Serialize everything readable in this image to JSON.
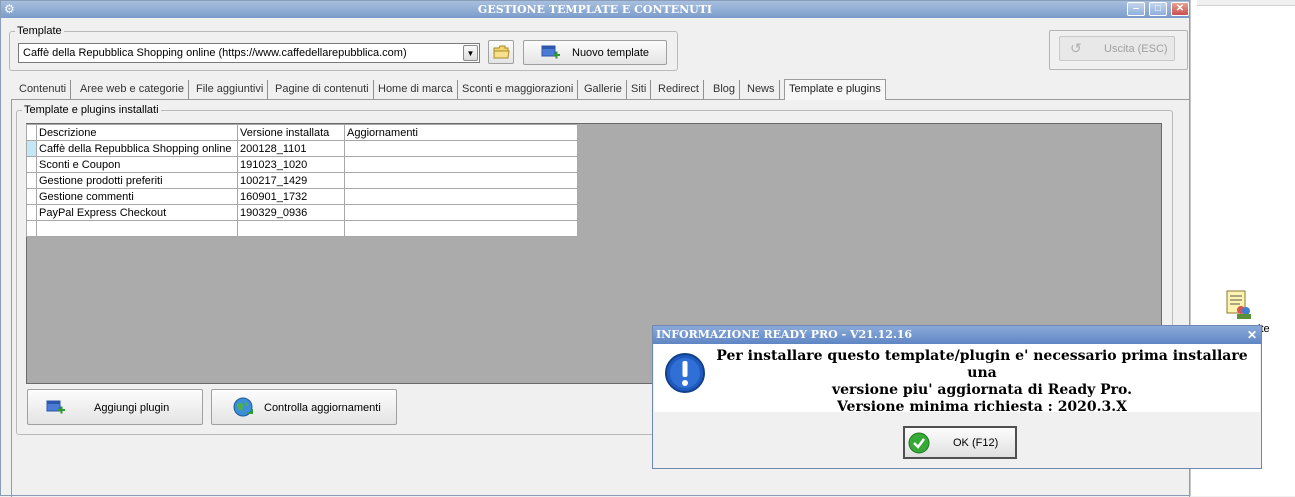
{
  "window": {
    "title": "GESTIONE TEMPLATE E CONTENUTI",
    "min_label": "‒",
    "max_label": "□",
    "close_label": "✕"
  },
  "template_group": {
    "legend": "Template",
    "selected": "Caffè della Repubblica Shopping online (https://www.caffedellarepubblica.com)",
    "new_label": "Nuovo template"
  },
  "exit_label": "Uscita (ESC)",
  "tabs": [
    {
      "label": "Contenuti",
      "active": false
    },
    {
      "label": "Aree web e categorie",
      "active": false
    },
    {
      "label": "File aggiuntivi",
      "active": false
    },
    {
      "label": "Pagine di contenuti",
      "active": false
    },
    {
      "label": "Home di marca",
      "active": false
    },
    {
      "label": "Sconti e maggiorazioni",
      "active": false
    },
    {
      "label": "Gallerie",
      "active": false
    },
    {
      "label": "Siti",
      "active": false
    },
    {
      "label": "Redirect",
      "active": false
    },
    {
      "label": "Blog",
      "active": false
    },
    {
      "label": "News",
      "active": false
    },
    {
      "label": "Template e plugins",
      "active": true
    }
  ],
  "plugins_group": {
    "legend": "Template e plugins installati",
    "columns": [
      "Descrizione",
      "Versione installata",
      "Aggiornamenti"
    ],
    "rows": [
      [
        "Caffè della Repubblica Shopping online",
        "200128_1101",
        ""
      ],
      [
        "Sconti e Coupon",
        "191023_1020",
        ""
      ],
      [
        "Gestione prodotti preferiti",
        "100217_1429",
        ""
      ],
      [
        "Gestione commenti",
        "160901_1732",
        ""
      ],
      [
        "PayPal Express Checkout",
        "190329_0936",
        ""
      ],
      [
        "",
        "",
        ""
      ]
    ],
    "add_label": "Aggiungi plugin",
    "check_label": "Controlla aggiornamenti"
  },
  "side_panel": {
    "label": "ite"
  },
  "dialog": {
    "title": "INFORMAZIONE READY PRO - V21.12.16",
    "close_label": "✕",
    "message_lines": [
      "Per installare questo template/plugin e' necessario prima installare una",
      "versione piu' aggiornata di Ready Pro.",
      "Versione minima richiesta : 2020.3.X"
    ],
    "ok_label": "OK (F12)"
  },
  "colors": {
    "titlebar": "#7a9ccb",
    "grid_background": "#ababab",
    "selected_indicator": "#c4e7f7",
    "info_icon": "#1f5bbf"
  }
}
